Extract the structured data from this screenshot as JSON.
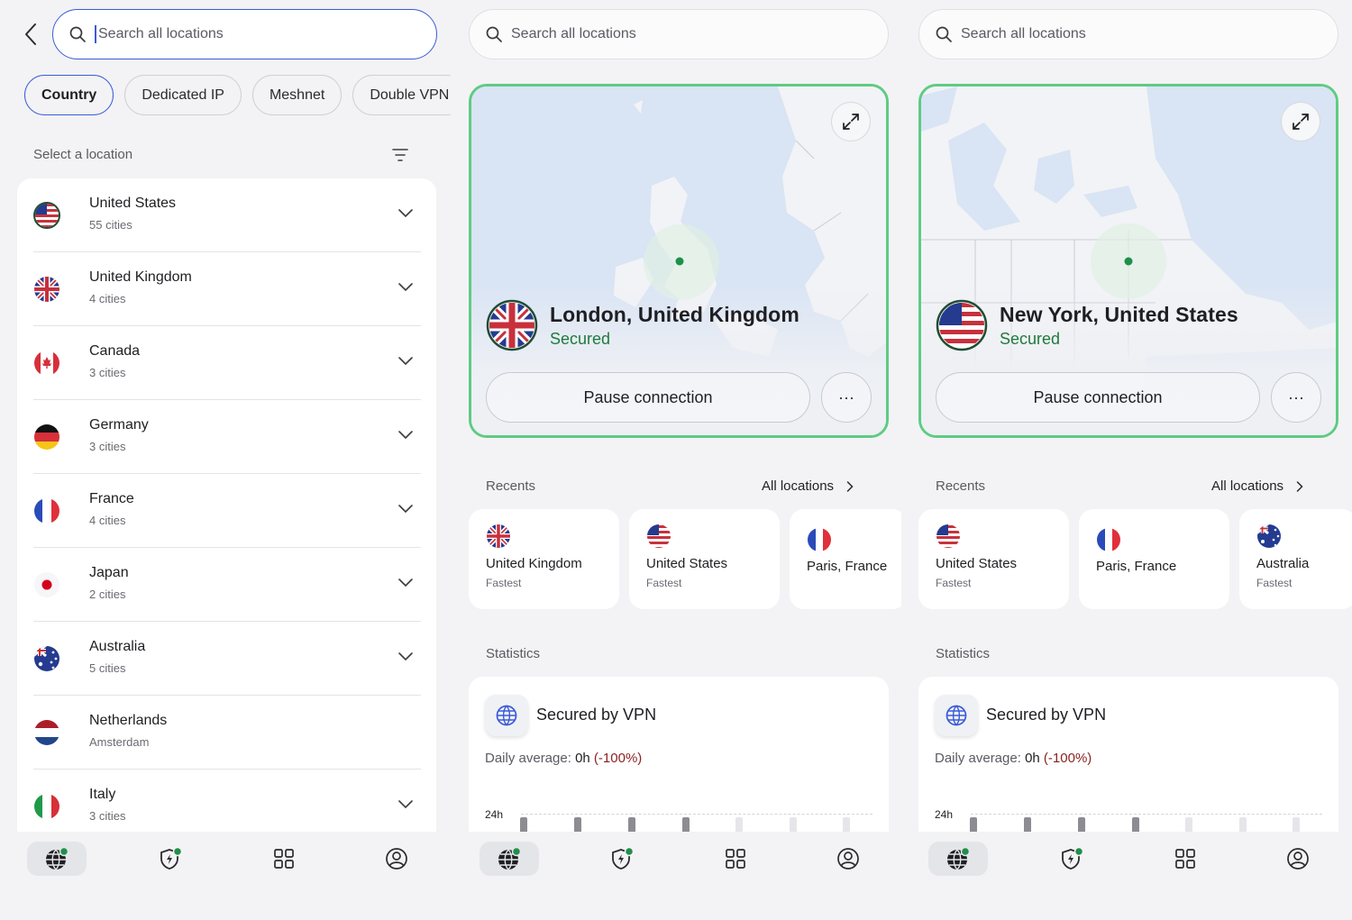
{
  "colors": {
    "accent": "#3a5bd9",
    "connected": "#5fcb83",
    "secured_text": "#1f7a3c",
    "negative": "#8c2222"
  },
  "panel1": {
    "search": {
      "placeholder": "Search all locations"
    },
    "chips": [
      "Country",
      "Dedicated IP",
      "Meshnet",
      "Double VPN"
    ],
    "active_chip": "Country",
    "section_label": "Select a location",
    "countries": [
      {
        "name": "United States",
        "sub": "55 cities",
        "flag": "us",
        "expandable": true
      },
      {
        "name": "United Kingdom",
        "sub": "4 cities",
        "flag": "uk",
        "expandable": true
      },
      {
        "name": "Canada",
        "sub": "3 cities",
        "flag": "ca",
        "expandable": true
      },
      {
        "name": "Germany",
        "sub": "3 cities",
        "flag": "de",
        "expandable": true
      },
      {
        "name": "France",
        "sub": "4 cities",
        "flag": "fr",
        "expandable": true
      },
      {
        "name": "Japan",
        "sub": "2 cities",
        "flag": "jp",
        "expandable": true
      },
      {
        "name": "Australia",
        "sub": "5 cities",
        "flag": "au",
        "expandable": true
      },
      {
        "name": "Netherlands",
        "sub": "Amsterdam",
        "flag": "nl",
        "expandable": false
      },
      {
        "name": "Italy",
        "sub": "3 cities",
        "flag": "it",
        "expandable": true
      }
    ]
  },
  "panel2": {
    "search": {
      "placeholder": "Search all locations"
    },
    "connection": {
      "title": "London, United Kingdom",
      "status": "Secured",
      "pause_label": "Pause connection",
      "more_label": "···",
      "flag": "uk"
    },
    "recents_label": "Recents",
    "all_locations": "All locations",
    "recents": [
      {
        "name": "United Kingdom",
        "sub": "Fastest",
        "flag": "uk"
      },
      {
        "name": "United States",
        "sub": "Fastest",
        "flag": "us"
      },
      {
        "name": "Paris, France",
        "sub": "",
        "flag": "fr"
      }
    ],
    "statistics_label": "Statistics",
    "stats": {
      "title": "Secured by VPN",
      "daily_label": "Daily average:",
      "daily_value": "0h",
      "daily_change": "(-100%)",
      "y_label": "24h"
    }
  },
  "panel3": {
    "search": {
      "placeholder": "Search all locations"
    },
    "connection": {
      "title": "New York, United States",
      "status": "Secured",
      "pause_label": "Pause connection",
      "more_label": "···",
      "flag": "us"
    },
    "recents_label": "Recents",
    "all_locations": "All locations",
    "recents": [
      {
        "name": "United States",
        "sub": "Fastest",
        "flag": "us"
      },
      {
        "name": "Paris, France",
        "sub": "",
        "flag": "fr"
      },
      {
        "name": "Australia",
        "sub": "Fastest",
        "flag": "au"
      }
    ],
    "statistics_label": "Statistics",
    "stats": {
      "title": "Secured by VPN",
      "daily_label": "Daily average:",
      "daily_value": "0h",
      "daily_change": "(-100%)",
      "y_label": "24h"
    }
  },
  "bottom_nav": [
    {
      "name": "globe-icon",
      "active": true,
      "badge": true
    },
    {
      "name": "shield-bolt-icon",
      "active": false,
      "badge": true
    },
    {
      "name": "grid-icon",
      "active": false,
      "badge": false
    },
    {
      "name": "profile-icon",
      "active": false,
      "badge": false
    }
  ]
}
